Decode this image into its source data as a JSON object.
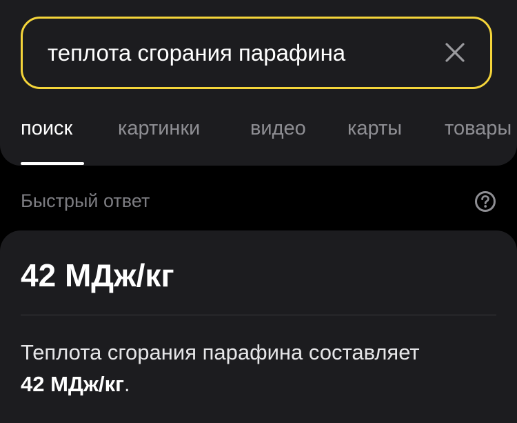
{
  "search": {
    "query": "теплота сгорания парафина",
    "clear_icon": "close-icon"
  },
  "tabs": [
    {
      "label": "поиск",
      "active": true
    },
    {
      "label": "картинки",
      "active": false
    },
    {
      "label": "видео",
      "active": false
    },
    {
      "label": "карты",
      "active": false
    },
    {
      "label": "товары",
      "active": false
    }
  ],
  "quick_answer": {
    "header": "Быстрый ответ",
    "help_icon": "question-circle-icon",
    "value": "42 МДж/кг",
    "description_prefix": "Теплота сгорания парафина составляет",
    "description_value": "42 МДж/кг",
    "description_suffix": "."
  },
  "colors": {
    "accent": "#f5d53a",
    "panel": "#1c1c1f",
    "background": "#000000",
    "muted_text": "#8e8e93"
  }
}
